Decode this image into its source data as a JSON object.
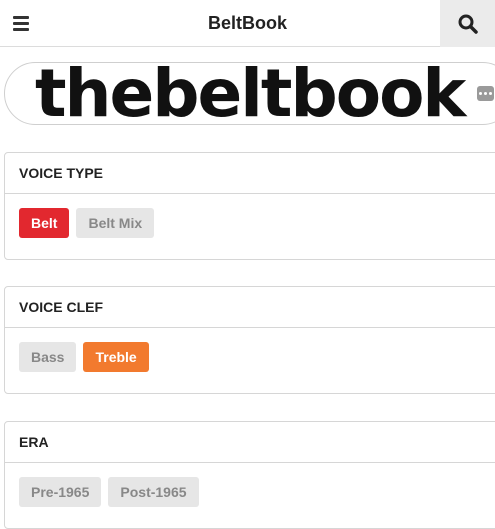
{
  "header": {
    "menu_icon": "hamburger-menu-icon",
    "title": "BeltBook",
    "search_icon": "search-icon"
  },
  "logo": {
    "text": "thebeltbook",
    "more_icon": "more-dots-icon"
  },
  "filters": [
    {
      "heading": "VOICE TYPE",
      "options": [
        {
          "label": "Belt",
          "selected": true,
          "color": "#e2282f"
        },
        {
          "label": "Belt Mix",
          "selected": false
        }
      ]
    },
    {
      "heading": "VOICE CLEF",
      "options": [
        {
          "label": "Bass",
          "selected": false
        },
        {
          "label": "Treble",
          "selected": true,
          "color": "#f27a2e"
        }
      ]
    },
    {
      "heading": "ERA",
      "options": [
        {
          "label": "Pre-1965",
          "selected": false
        },
        {
          "label": "Post-1965",
          "selected": false
        }
      ]
    }
  ],
  "colors": {
    "accent_red": "#e2282f",
    "accent_orange": "#f27a2e",
    "chip_unselected": "#e6e6e6"
  }
}
